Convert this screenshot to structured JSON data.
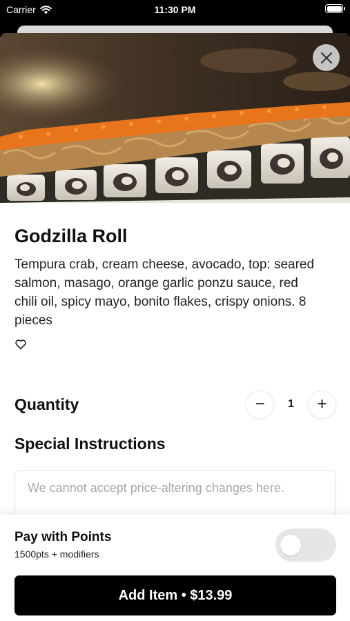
{
  "status_bar": {
    "carrier": "Carrier",
    "time": "11:30 PM"
  },
  "item": {
    "name": "Godzilla Roll",
    "description": "Tempura crab, cream cheese, avocado, top: seared salmon, masago, orange garlic ponzu sauce, red chili oil, spicy mayo, bonito flakes, crispy onions. 8 pieces",
    "image_icon": "sushi-roll-photo",
    "favorite_icon": "heart-outline-icon"
  },
  "quantity": {
    "label": "Quantity",
    "value": "1",
    "decrement": "−",
    "increment": "+"
  },
  "special_instructions": {
    "label": "Special Instructions",
    "placeholder": "We cannot accept price-altering changes here.",
    "value": ""
  },
  "points": {
    "title": "Pay with Points",
    "subtitle": "1500pts + modifiers",
    "enabled": false
  },
  "add_button": {
    "label": "Add Item • $13.99"
  },
  "colors": {
    "primary": "#000000",
    "masago": "#e8741c",
    "toggle_off": "#e6e6e6"
  }
}
